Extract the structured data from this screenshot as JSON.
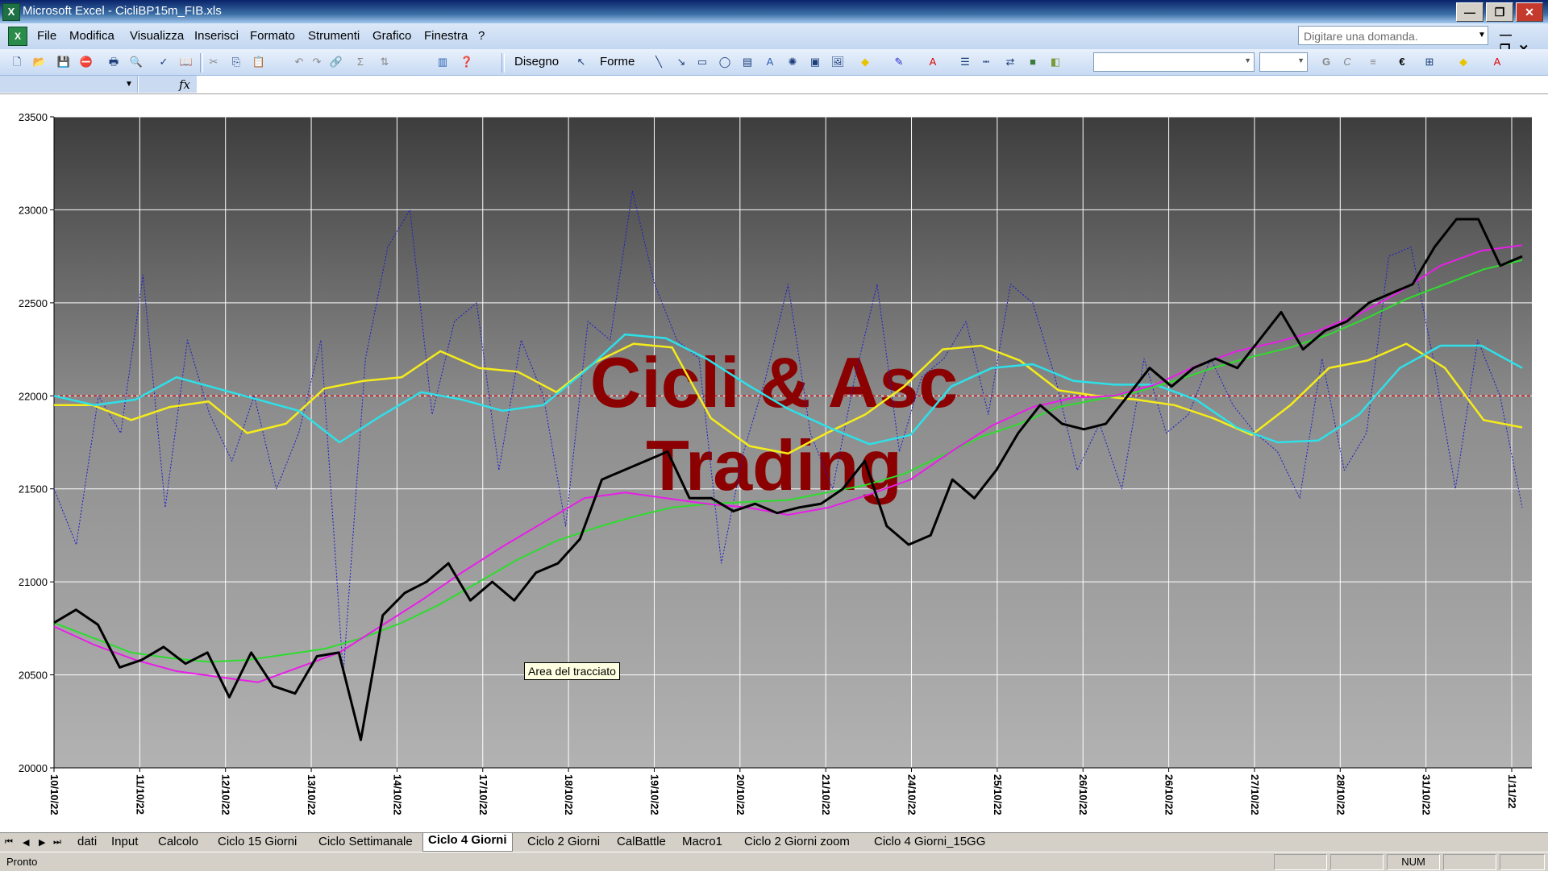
{
  "window": {
    "app_title": "Microsoft Excel - CicliBP15m_FIB.xls",
    "minimize": "—",
    "restore": "❐",
    "close": "✕"
  },
  "menu": {
    "items": [
      "File",
      "Modifica",
      "Visualizza",
      "Inserisci",
      "Formato",
      "Strumenti",
      "Grafico",
      "Finestra",
      "?"
    ],
    "ask_placeholder": "Digitare una domanda.",
    "doc_controls": "—❐✕"
  },
  "toolbar": {
    "draw_label": "Disegno",
    "shapes_label": "Forme",
    "sigma": "Σ",
    "euro": "€",
    "bold_g": "G",
    "italic_c": "C"
  },
  "formula_bar": {
    "fx": "fx"
  },
  "chart_data": {
    "type": "line",
    "watermark": [
      "Cicli & Asc",
      "Trading"
    ],
    "tooltip": "Area del tracciato",
    "ylim": [
      20000,
      23500
    ],
    "y_ticks": [
      20000,
      20500,
      21000,
      21500,
      22000,
      22500,
      23000,
      23500
    ],
    "x_labels": [
      "10/10/22",
      "11/10/22",
      "12/10/22",
      "13/10/22",
      "14/10/22",
      "17/10/22",
      "18/10/22",
      "19/10/22",
      "20/10/22",
      "21/10/22",
      "24/10/22",
      "25/10/22",
      "26/10/22",
      "26/10/22",
      "27/10/22",
      "28/10/22",
      "31/10/22",
      "1/11/22"
    ],
    "reference_line": 22000,
    "grid": true,
    "legend": "none",
    "colors": {
      "price": "#000000",
      "green": "#2edc2e",
      "magenta": "#e81ee8",
      "yellow": "#f5ec1a",
      "cyan": "#2ee0e8",
      "oscillator": "#1a1ad0",
      "reference": "#d02020",
      "watermark": "#8b0000"
    },
    "series": [
      {
        "key": "price",
        "values": [
          20780,
          20850,
          20770,
          20540,
          20580,
          20650,
          20560,
          20620,
          20380,
          20620,
          20440,
          20400,
          20600,
          20620,
          20150,
          20820,
          20940,
          21000,
          21100,
          20900,
          21000,
          20900,
          21050,
          21100,
          21230,
          21550,
          21600,
          21650,
          21700,
          21450,
          21450,
          21380,
          21420,
          21370,
          21400,
          21420,
          21500,
          21650,
          21300,
          21200,
          21250,
          21550,
          21450,
          21600,
          21800,
          21950,
          21850,
          21820,
          21850,
          22000,
          22150,
          22050,
          22150,
          22200,
          22150,
          22300,
          22450,
          22250,
          22350,
          22400,
          22500,
          22550,
          22600,
          22800,
          22950,
          22950,
          22700,
          22750
        ]
      },
      {
        "key": "green",
        "values": [
          20780,
          20700,
          20620,
          20590,
          20570,
          20580,
          20610,
          20640,
          20700,
          20780,
          20880,
          21000,
          21120,
          21220,
          21290,
          21350,
          21400,
          21420,
          21430,
          21440,
          21480,
          21520,
          21580,
          21680,
          21780,
          21850,
          21940,
          21980,
          22020,
          22080,
          22150,
          22210,
          22260,
          22330,
          22420,
          22520,
          22600,
          22680,
          22730
        ]
      },
      {
        "key": "magenta",
        "values": [
          20760,
          20660,
          20580,
          20520,
          20490,
          20460,
          20540,
          20620,
          20760,
          20900,
          21050,
          21190,
          21320,
          21450,
          21480,
          21450,
          21420,
          21400,
          21360,
          21400,
          21470,
          21550,
          21700,
          21840,
          21940,
          21990,
          22000,
          22060,
          22160,
          22240,
          22290,
          22350,
          22440,
          22560,
          22700,
          22780,
          22810
        ]
      },
      {
        "key": "yellow",
        "values": [
          21950,
          21950,
          21870,
          21940,
          21970,
          21800,
          21850,
          22040,
          22080,
          22100,
          22240,
          22150,
          22130,
          22020,
          22180,
          22280,
          22260,
          21880,
          21730,
          21690,
          21800,
          21900,
          22050,
          22250,
          22270,
          22190,
          22030,
          22000,
          21980,
          21950,
          21880,
          21790,
          21950,
          22150,
          22190,
          22280,
          22150,
          21870,
          21830
        ]
      },
      {
        "key": "cyan",
        "values": [
          22000,
          21950,
          21980,
          22100,
          22040,
          21980,
          21920,
          21750,
          21890,
          22020,
          21980,
          21920,
          21950,
          22130,
          22330,
          22310,
          22200,
          22060,
          21930,
          21830,
          21740,
          21790,
          22050,
          22150,
          22170,
          22080,
          22060,
          22060,
          21980,
          21830,
          21750,
          21760,
          21900,
          22150,
          22270,
          22270,
          22150
        ]
      },
      {
        "key": "oscillator",
        "values": [
          21500,
          21200,
          22000,
          21800,
          22650,
          21400,
          22300,
          21900,
          21650,
          22000,
          21500,
          21800,
          22300,
          20500,
          22200,
          22800,
          23000,
          21900,
          22400,
          22500,
          21600,
          22300,
          22000,
          21300,
          22400,
          22300,
          23100,
          22600,
          22300,
          22200,
          21100,
          21700,
          22100,
          22600,
          21800,
          21500,
          22100,
          22600,
          21700,
          22100,
          22200,
          22400,
          21900,
          22600,
          22500,
          22100,
          21600,
          21850,
          21500,
          22200,
          21800,
          21900,
          22200,
          21950,
          21800,
          21700,
          21450,
          22200,
          21600,
          21800,
          22750,
          22800,
          22200,
          21500,
          22300,
          22000,
          21400
        ]
      }
    ]
  },
  "sheets": {
    "tabs": [
      "dati",
      "Input",
      "Calcolo",
      "Ciclo 15 Giorni",
      "Ciclo Settimanale",
      "Ciclo 4 Giorni",
      "Ciclo 2 Giorni",
      "CalBattle",
      "Macro1",
      "Ciclo 2 Giorni zoom",
      "Ciclo 4 Giorni_15GG"
    ],
    "active": "Ciclo 4 Giorni",
    "nav": [
      "⏮",
      "◀",
      "▶",
      "⏭"
    ]
  },
  "status": {
    "text": "Pronto",
    "num": "NUM"
  }
}
